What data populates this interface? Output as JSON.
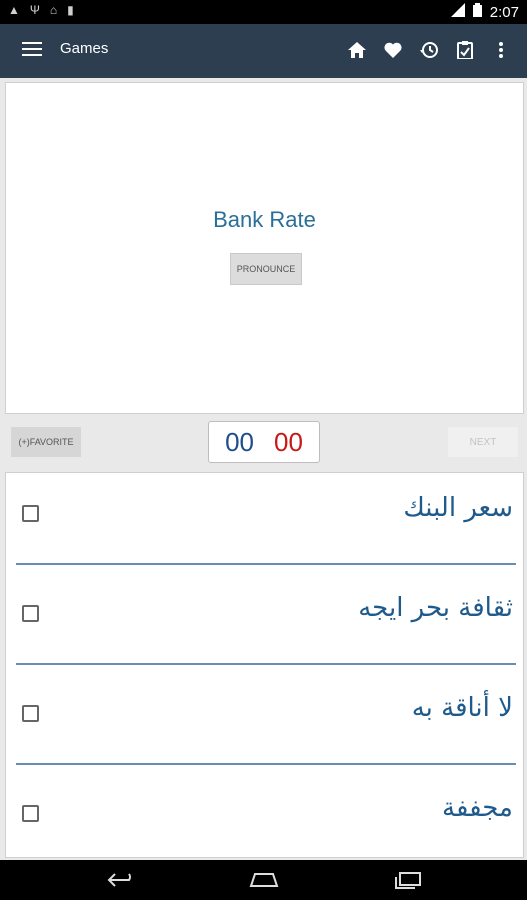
{
  "status_bar": {
    "time": "2:07"
  },
  "app_bar": {
    "title": "Games",
    "actions": [
      "home-icon",
      "heart-icon",
      "history-icon",
      "clipboard-icon",
      "more-icon"
    ]
  },
  "card": {
    "word": "Bank Rate",
    "pronounce_label": "PRONOUNCE"
  },
  "controls": {
    "favorite_label": "(+)FAVORITE",
    "timer_left": "00",
    "timer_right": "00",
    "next_label": "NEXT"
  },
  "options": [
    {
      "text": "سعر البنك"
    },
    {
      "text": "ثقافة بحر ايجه"
    },
    {
      "text": "لا أناقة به"
    },
    {
      "text": "مجففة"
    }
  ],
  "colors": {
    "app_bar": "#2c3e50",
    "word": "#2a6f97",
    "option_text": "#1f5a8c",
    "timer_blue": "#1f4e8c",
    "timer_red": "#c81818",
    "divider": "#6a8db7"
  }
}
